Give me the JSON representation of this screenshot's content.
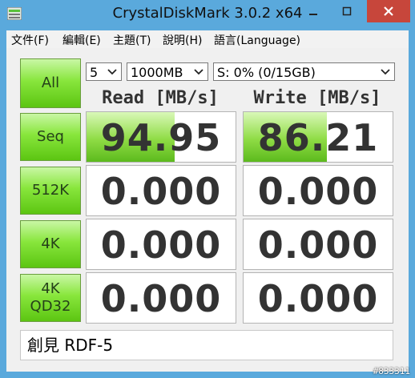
{
  "window": {
    "title": "CrystalDiskMark 3.0.2 x64"
  },
  "menu": [
    "文件(F)",
    "編輯(E)",
    "主題(T)",
    "說明(H)",
    "語言(Language)"
  ],
  "controls": {
    "test_count": "5",
    "test_size": "1000MB",
    "drive": "S: 0% (0/15GB)"
  },
  "buttons": {
    "all": "All",
    "seq": "Seq",
    "k512": "512K",
    "k4": "4K",
    "k4qd32_line1": "4K",
    "k4qd32_line2": "QD32"
  },
  "headers": {
    "read": "Read [MB/s]",
    "write": "Write [MB/s]"
  },
  "results": {
    "seq": {
      "read": "94.95",
      "write": "86.21",
      "read_fill": 0.59,
      "write_fill": 0.56
    },
    "k512": {
      "read": "0.000",
      "write": "0.000"
    },
    "k4": {
      "read": "0.000",
      "write": "0.000"
    },
    "k4qd32": {
      "read": "0.000",
      "write": "0.000"
    }
  },
  "comment": "創見 RDF-5",
  "watermark": "#833311",
  "colors": {
    "titlebar": "#5aa9dc",
    "close": "#c7463b",
    "green_button": "#7ad72e",
    "value_text": "#333333"
  }
}
